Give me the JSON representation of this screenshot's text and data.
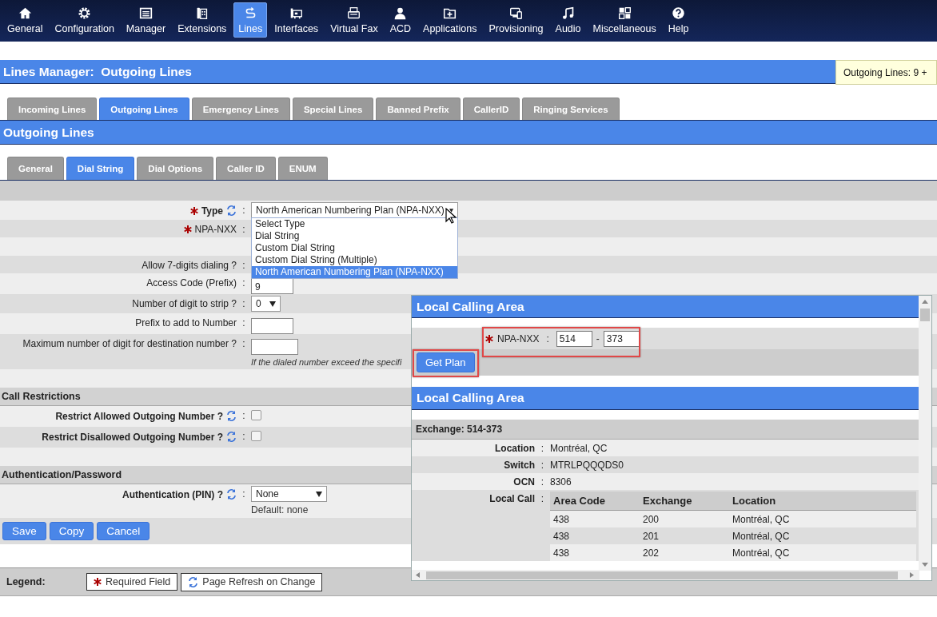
{
  "nav": {
    "items": [
      {
        "label": "General",
        "selected": false
      },
      {
        "label": "Configuration",
        "selected": false
      },
      {
        "label": "Manager",
        "selected": false
      },
      {
        "label": "Extensions",
        "selected": false
      },
      {
        "label": "Lines",
        "selected": true
      },
      {
        "label": "Interfaces",
        "selected": false
      },
      {
        "label": "Virtual Fax",
        "selected": false
      },
      {
        "label": "ACD",
        "selected": false
      },
      {
        "label": "Applications",
        "selected": false
      },
      {
        "label": "Provisioning",
        "selected": false
      },
      {
        "label": "Audio",
        "selected": false
      },
      {
        "label": "Miscellaneous",
        "selected": false
      },
      {
        "label": "Help",
        "selected": false
      }
    ]
  },
  "page_title": "Lines Manager:  Outgoing Lines",
  "tooltip": "Outgoing Lines: 9 +",
  "tabs": [
    {
      "label": "Incoming Lines",
      "selected": false
    },
    {
      "label": "Outgoing Lines",
      "selected": true
    },
    {
      "label": "Emergency Lines",
      "selected": false
    },
    {
      "label": "Special Lines",
      "selected": false
    },
    {
      "label": "Banned Prefix",
      "selected": false
    },
    {
      "label": "CallerID",
      "selected": false
    },
    {
      "label": "Ringing Services",
      "selected": false
    }
  ],
  "section_title": "Outgoing Lines",
  "subtabs": [
    {
      "label": "General",
      "selected": false
    },
    {
      "label": "Dial String",
      "selected": true
    },
    {
      "label": "Dial Options",
      "selected": false
    },
    {
      "label": "Caller ID",
      "selected": false
    },
    {
      "label": "ENUM",
      "selected": false
    }
  ],
  "form": {
    "rows": [
      {
        "kind": "select",
        "label": "Type",
        "required": true,
        "refresh": true,
        "colon": ":",
        "value": "North American Numbering Plan (NPA-NXX)",
        "open": true,
        "options": [
          {
            "label": "Select Type",
            "selected": false
          },
          {
            "label": "Dial String",
            "selected": false
          },
          {
            "label": "Custom Dial String",
            "selected": false
          },
          {
            "label": "Custom Dial String (Multiple)",
            "selected": false
          },
          {
            "label": "North American Numbering Plan (NPA-NXX)",
            "selected": true
          }
        ]
      },
      {
        "kind": "label",
        "label": "NPA-NXX",
        "required": true,
        "refresh": false,
        "colon": ":"
      },
      {
        "kind": "blank"
      },
      {
        "kind": "label",
        "label": "Allow 7-digits dialing ?",
        "required": false,
        "refresh": false,
        "colon": ":"
      },
      {
        "kind": "input",
        "label": "Access Code (Prefix)",
        "required": false,
        "refresh": false,
        "colon": ":",
        "value": "9"
      },
      {
        "kind": "select",
        "label": "Number of digit to strip ?",
        "required": false,
        "refresh": false,
        "colon": ":",
        "value": "0",
        "open": false
      },
      {
        "kind": "input",
        "label": "Prefix to add to Number",
        "required": false,
        "refresh": false,
        "colon": ":"
      },
      {
        "kind": "input",
        "label": "Maximum number of digit for destination number ?",
        "required": false,
        "refresh": false,
        "colon": ":",
        "hint": "If the dialed number exceed the specifi"
      },
      {
        "kind": "blank"
      },
      {
        "kind": "header",
        "label": "Call Restrictions"
      },
      {
        "kind": "checkbox",
        "label": "Restrict Allowed Outgoing Number ?",
        "required": false,
        "refresh": true,
        "colon": ":",
        "checked": false
      },
      {
        "kind": "checkbox",
        "label": "Restrict Disallowed Outgoing Number ?",
        "required": false,
        "refresh": true,
        "colon": ":",
        "checked": false
      },
      {
        "kind": "blank"
      },
      {
        "kind": "header",
        "label": "Authentication/Password"
      },
      {
        "kind": "select",
        "label": "Authentication (PIN) ?",
        "required": false,
        "refresh": true,
        "colon": ":",
        "value": "None",
        "open": false,
        "note": "Default: none"
      },
      {
        "kind": "buttons",
        "buttons": [
          "Save",
          "Copy",
          "Cancel"
        ]
      }
    ]
  },
  "legend": {
    "label": "Legend:",
    "items": [
      {
        "kind": "required",
        "text": "Required Field"
      },
      {
        "kind": "refresh",
        "text": "Page Refresh on Change"
      }
    ]
  },
  "popup": {
    "title": "Local Calling Area",
    "npa_label": "NPA-NXX",
    "colon": ":",
    "npa": "514",
    "dash": "-",
    "nxx": "373",
    "button": "Get Plan",
    "result_title": "Local Calling Area",
    "exchange": "Exchange: 514-373",
    "details": [
      {
        "label": "Location",
        "colon": ":",
        "value": "Montréal, QC"
      },
      {
        "label": "Switch",
        "colon": ":",
        "value": "MTRLPQQQDS0"
      },
      {
        "label": "OCN",
        "colon": ":",
        "value": "8306"
      }
    ],
    "local_call_label": "Local Call",
    "local_call_colon": ":",
    "table": {
      "columns": [
        "Area Code",
        "Exchange",
        "Location"
      ],
      "rows": [
        [
          "438",
          "200",
          "Montréal, QC"
        ],
        [
          "438",
          "201",
          "Montréal, QC"
        ],
        [
          "438",
          "202",
          "Montréal, QC"
        ]
      ]
    }
  }
}
